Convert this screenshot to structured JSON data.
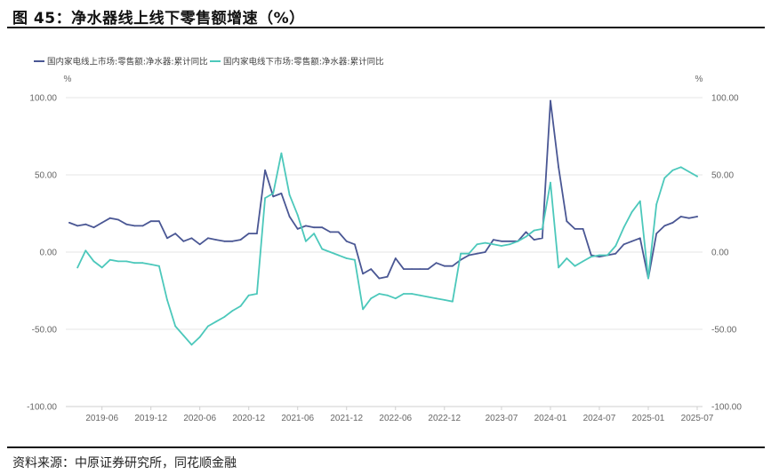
{
  "figure": {
    "title": "图 45：净水器线上线下零售额增速（%）",
    "source": "资料来源：中原证券研究所，同花顺金融"
  },
  "chart_data": {
    "type": "line",
    "x_tick_labels": [
      "2019-06",
      "2019-12",
      "2020-06",
      "2020-12",
      "2021-06",
      "2021-12",
      "2022-06",
      "2022-12",
      "2023-07",
      "2024-01",
      "2024-07",
      "2025-01",
      "2025-07"
    ],
    "y_tick_labels": [
      "100.00",
      "50.00",
      "0.00",
      "-50.00",
      "-100.00"
    ],
    "ylim": [
      -100,
      100
    ],
    "y_unit_left": "%",
    "y_unit_right": "%",
    "legend_position": "top-left",
    "grid": "horizontal",
    "colors": {
      "online": "#4a5794",
      "offline": "#4cc8bb"
    },
    "x": [
      "2019-02",
      "2019-03",
      "2019-04",
      "2019-05",
      "2019-06",
      "2019-07",
      "2019-08",
      "2019-09",
      "2019-10",
      "2019-11",
      "2019-12",
      "2020-01",
      "2020-02",
      "2020-03",
      "2020-04",
      "2020-05",
      "2020-06",
      "2020-07",
      "2020-08",
      "2020-09",
      "2020-10",
      "2020-11",
      "2020-12",
      "2021-01",
      "2021-02",
      "2021-03",
      "2021-04",
      "2021-05",
      "2021-06",
      "2021-07",
      "2021-08",
      "2021-09",
      "2021-10",
      "2021-11",
      "2021-12",
      "2022-01",
      "2022-02",
      "2022-03",
      "2022-04",
      "2022-05",
      "2022-06",
      "2022-07",
      "2022-08",
      "2022-09",
      "2022-10",
      "2022-11",
      "2022-12",
      "2023-01",
      "2023-02",
      "2023-03",
      "2023-04",
      "2023-05",
      "2023-06",
      "2023-07",
      "2023-08",
      "2023-09",
      "2023-10",
      "2023-11",
      "2023-12",
      "2024-01",
      "2024-02",
      "2024-03",
      "2024-04",
      "2024-05",
      "2024-06",
      "2024-07",
      "2024-08",
      "2024-09",
      "2024-10",
      "2024-11",
      "2024-12",
      "2025-01",
      "2025-02",
      "2025-03",
      "2025-04",
      "2025-05",
      "2025-06",
      "2025-07"
    ],
    "series": [
      {
        "name": "国内家电线上市场:零售额:净水器:累计同比",
        "key": "online",
        "values": [
          19,
          17,
          18,
          16,
          19,
          22,
          21,
          18,
          17,
          17,
          20,
          20,
          9,
          12,
          7,
          9,
          5,
          9,
          8,
          7,
          7,
          8,
          12,
          12,
          53,
          36,
          38,
          23,
          15,
          17,
          16,
          16,
          13,
          13,
          7,
          5,
          -14,
          -11,
          -17,
          -16,
          -4,
          -11,
          -11,
          -11,
          -11,
          -7,
          -9,
          -9,
          -5,
          -2,
          -1,
          0,
          8,
          7,
          7,
          7,
          13,
          8,
          9,
          98,
          55,
          20,
          15,
          15,
          -2,
          -3,
          -2,
          -1,
          5,
          7,
          9,
          -17,
          12,
          17,
          19,
          23,
          22,
          23
        ]
      },
      {
        "name": "国内家电线下市场:零售额:净水器:累计同比",
        "key": "offline",
        "values": [
          null,
          -10,
          1,
          -6,
          -10,
          -5,
          -6,
          -6,
          -7,
          -7,
          -8,
          -9,
          -31,
          -48,
          -54,
          -60,
          -55,
          -48,
          -45,
          -42,
          -38,
          -35,
          -28,
          -27,
          35,
          38,
          64,
          37,
          24,
          7,
          12,
          2,
          0,
          -2,
          -4,
          -5,
          -37,
          -30,
          -27,
          -28,
          -30,
          -27,
          -27,
          -28,
          -29,
          -30,
          -31,
          -32,
          -1,
          -1,
          5,
          6,
          5,
          4,
          5,
          7,
          10,
          14,
          15,
          45,
          -10,
          -4,
          -9,
          -6,
          -3,
          -2,
          -2,
          4,
          16,
          26,
          33,
          -17,
          31,
          48,
          53,
          55,
          52,
          49
        ]
      }
    ]
  }
}
